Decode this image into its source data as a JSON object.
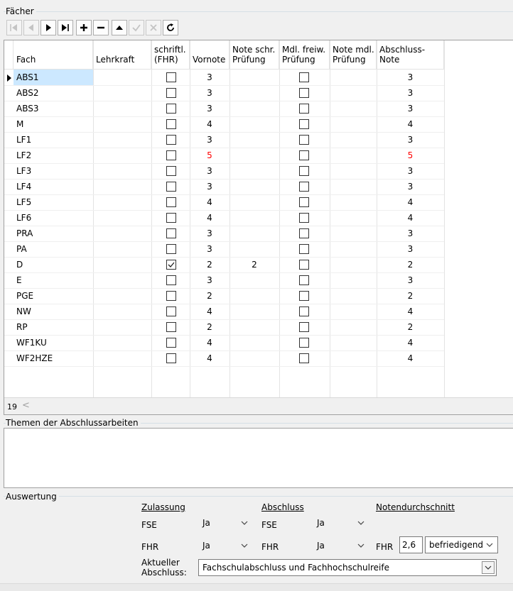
{
  "faecher": {
    "group_label": "Fächer",
    "nav_buttons": [
      {
        "icon": "first-record-icon",
        "enabled": false
      },
      {
        "icon": "prior-record-icon",
        "enabled": false
      },
      {
        "icon": "next-record-icon",
        "enabled": true
      },
      {
        "icon": "last-record-icon",
        "enabled": true
      },
      {
        "icon": "insert-record-icon",
        "enabled": true
      },
      {
        "icon": "delete-record-icon",
        "enabled": true
      },
      {
        "icon": "edit-record-icon",
        "enabled": true
      },
      {
        "icon": "post-record-icon",
        "enabled": false
      },
      {
        "icon": "cancel-record-icon",
        "enabled": false
      },
      {
        "icon": "refresh-record-icon",
        "enabled": true
      }
    ],
    "columns": {
      "fach": "Fach",
      "lehrkraft": "Lehrkraft",
      "schriftl_1": "schriftl.",
      "schriftl_2": "(FHR)",
      "vornote": "Vornote",
      "note_schr_1": "Note schr.",
      "note_schr_2": "Prüfung",
      "mdl_freiw_1": "Mdl. freiw.",
      "mdl_freiw_2": "Prüfung",
      "note_mdl_1": "Note mdl.",
      "note_mdl_2": "Prüfung",
      "abschluss_1": "Abschluss-",
      "abschluss_2": "Note"
    },
    "rows": [
      {
        "fach": "ABS1",
        "lehrkraft": "",
        "schriftl": false,
        "vornote": "3",
        "note_schr": "",
        "mdl_freiw": false,
        "note_mdl": "",
        "abschluss": "3",
        "red": false
      },
      {
        "fach": "ABS2",
        "lehrkraft": "",
        "schriftl": false,
        "vornote": "3",
        "note_schr": "",
        "mdl_freiw": false,
        "note_mdl": "",
        "abschluss": "3",
        "red": false
      },
      {
        "fach": "ABS3",
        "lehrkraft": "",
        "schriftl": false,
        "vornote": "3",
        "note_schr": "",
        "mdl_freiw": false,
        "note_mdl": "",
        "abschluss": "3",
        "red": false
      },
      {
        "fach": "M",
        "lehrkraft": "",
        "schriftl": false,
        "vornote": "4",
        "note_schr": "",
        "mdl_freiw": false,
        "note_mdl": "",
        "abschluss": "4",
        "red": false
      },
      {
        "fach": "LF1",
        "lehrkraft": "",
        "schriftl": false,
        "vornote": "3",
        "note_schr": "",
        "mdl_freiw": false,
        "note_mdl": "",
        "abschluss": "3",
        "red": false
      },
      {
        "fach": "LF2",
        "lehrkraft": "",
        "schriftl": false,
        "vornote": "5",
        "note_schr": "",
        "mdl_freiw": false,
        "note_mdl": "",
        "abschluss": "5",
        "red": true
      },
      {
        "fach": "LF3",
        "lehrkraft": "",
        "schriftl": false,
        "vornote": "3",
        "note_schr": "",
        "mdl_freiw": false,
        "note_mdl": "",
        "abschluss": "3",
        "red": false
      },
      {
        "fach": "LF4",
        "lehrkraft": "",
        "schriftl": false,
        "vornote": "3",
        "note_schr": "",
        "mdl_freiw": false,
        "note_mdl": "",
        "abschluss": "3",
        "red": false
      },
      {
        "fach": "LF5",
        "lehrkraft": "",
        "schriftl": false,
        "vornote": "4",
        "note_schr": "",
        "mdl_freiw": false,
        "note_mdl": "",
        "abschluss": "4",
        "red": false
      },
      {
        "fach": "LF6",
        "lehrkraft": "",
        "schriftl": false,
        "vornote": "4",
        "note_schr": "",
        "mdl_freiw": false,
        "note_mdl": "",
        "abschluss": "4",
        "red": false
      },
      {
        "fach": "PRA",
        "lehrkraft": "",
        "schriftl": false,
        "vornote": "3",
        "note_schr": "",
        "mdl_freiw": false,
        "note_mdl": "",
        "abschluss": "3",
        "red": false
      },
      {
        "fach": "PA",
        "lehrkraft": "",
        "schriftl": false,
        "vornote": "3",
        "note_schr": "",
        "mdl_freiw": false,
        "note_mdl": "",
        "abschluss": "3",
        "red": false
      },
      {
        "fach": "D",
        "lehrkraft": "",
        "schriftl": true,
        "vornote": "2",
        "note_schr": "2",
        "mdl_freiw": false,
        "note_mdl": "",
        "abschluss": "2",
        "red": false
      },
      {
        "fach": "E",
        "lehrkraft": "",
        "schriftl": false,
        "vornote": "3",
        "note_schr": "",
        "mdl_freiw": false,
        "note_mdl": "",
        "abschluss": "3",
        "red": false
      },
      {
        "fach": "PGE",
        "lehrkraft": "",
        "schriftl": false,
        "vornote": "2",
        "note_schr": "",
        "mdl_freiw": false,
        "note_mdl": "",
        "abschluss": "2",
        "red": false
      },
      {
        "fach": "NW",
        "lehrkraft": "",
        "schriftl": false,
        "vornote": "4",
        "note_schr": "",
        "mdl_freiw": false,
        "note_mdl": "",
        "abschluss": "4",
        "red": false
      },
      {
        "fach": "RP",
        "lehrkraft": "",
        "schriftl": false,
        "vornote": "2",
        "note_schr": "",
        "mdl_freiw": false,
        "note_mdl": "",
        "abschluss": "2",
        "red": false
      },
      {
        "fach": "WF1KU",
        "lehrkraft": "",
        "schriftl": false,
        "vornote": "4",
        "note_schr": "",
        "mdl_freiw": false,
        "note_mdl": "",
        "abschluss": "4",
        "red": false
      },
      {
        "fach": "WF2HZE",
        "lehrkraft": "",
        "schriftl": false,
        "vornote": "4",
        "note_schr": "",
        "mdl_freiw": false,
        "note_mdl": "",
        "abschluss": "4",
        "red": false
      }
    ],
    "record_count": "19",
    "red_color": "#ff0000",
    "selection_color": "#cce8ff"
  },
  "themen": {
    "group_label": "Themen der Abschlussarbeiten",
    "text": ""
  },
  "auswertung": {
    "group_label": "Auswertung",
    "zulassung_title": "Zulassung",
    "abschluss_title": "Abschluss",
    "notendurchschnitt_title": "Notendurchschnitt",
    "zul_fse_label": "FSE",
    "zul_fse_value": "Ja",
    "zul_fhr_label": "FHR",
    "zul_fhr_value": "Ja",
    "abs_fse_label": "FSE",
    "abs_fse_value": "Ja",
    "abs_fhr_label": "FHR",
    "abs_fhr_value": "Ja",
    "nd_fhr_label": "FHR",
    "nd_fhr_value": "2,6",
    "nd_fhr_text": "befriedigend",
    "aktueller_label_1": "Aktueller",
    "aktueller_label_2": "Abschluss:",
    "aktueller_value": "Fachschulabschluss und Fachhochschulreife"
  }
}
